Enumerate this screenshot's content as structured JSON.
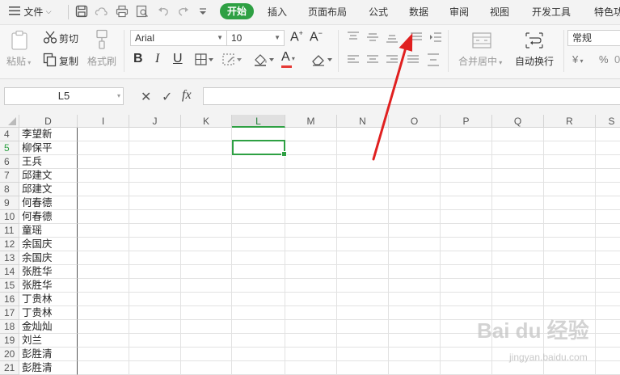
{
  "menubar": {
    "file_label": "文件",
    "tabs": [
      "开始",
      "插入",
      "页面布局",
      "公式",
      "数据",
      "审阅",
      "视图",
      "开发工具",
      "特色功"
    ]
  },
  "ribbon": {
    "paste_label": "粘贴",
    "cut_label": "剪切",
    "copy_label": "复制",
    "format_painter_label": "格式刷",
    "font_name": "Arial",
    "font_size": "10",
    "merge_label": "合并居中",
    "wrap_label": "自动换行",
    "number_format": "常规",
    "currency_symbol": "¥",
    "percent_symbol": "%",
    "font_color": "#e53935"
  },
  "formula_bar": {
    "name_box": "L5",
    "cancel_symbol": "✕",
    "confirm_symbol": "✓",
    "fx_symbol": "fx"
  },
  "grid": {
    "columns": [
      "D",
      "I",
      "J",
      "K",
      "L",
      "M",
      "N",
      "O",
      "P",
      "Q",
      "R",
      "S"
    ],
    "active_column": "L",
    "active_row": "5",
    "rows": [
      {
        "num": "4",
        "d": "李望新"
      },
      {
        "num": "5",
        "d": "柳保平"
      },
      {
        "num": "6",
        "d": "王兵"
      },
      {
        "num": "7",
        "d": "邱建文"
      },
      {
        "num": "8",
        "d": "邱建文"
      },
      {
        "num": "9",
        "d": "何春德"
      },
      {
        "num": "10",
        "d": "何春德"
      },
      {
        "num": "11",
        "d": "童瑶"
      },
      {
        "num": "12",
        "d": "余国庆"
      },
      {
        "num": "13",
        "d": "余国庆"
      },
      {
        "num": "14",
        "d": "张胜华"
      },
      {
        "num": "15",
        "d": "张胜华"
      },
      {
        "num": "16",
        "d": "丁贵林"
      },
      {
        "num": "17",
        "d": "丁贵林"
      },
      {
        "num": "18",
        "d": "金灿灿"
      },
      {
        "num": "19",
        "d": "刘兰"
      },
      {
        "num": "20",
        "d": "彭胜清"
      },
      {
        "num": "21",
        "d": "彭胜清"
      }
    ]
  },
  "annotation": {
    "arrow_color": "#e02020"
  },
  "watermark": {
    "brand": "Bai du 经验",
    "url": "jingyan.baidu.com"
  }
}
